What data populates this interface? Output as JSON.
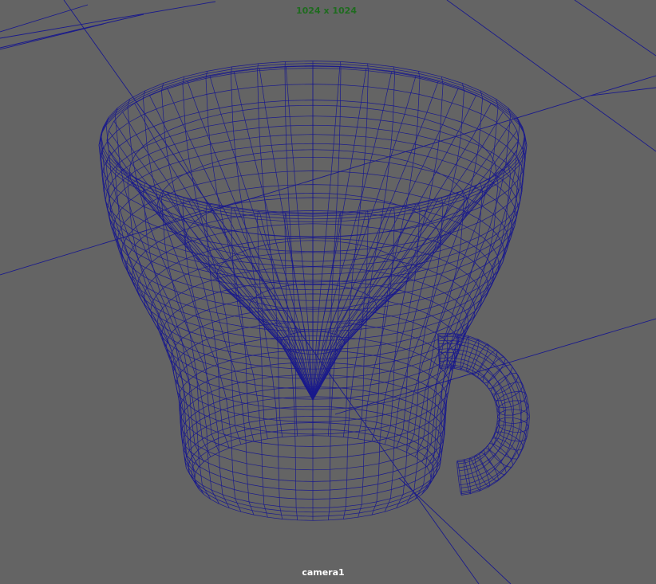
{
  "viewport": {
    "resolution_label": "1024 x 1024",
    "camera_name": "camera1",
    "display_mode": "wireframe",
    "object": "teacup-mesh"
  },
  "colors": {
    "background": "#646464",
    "wireframe": "#1a1a8c",
    "grid": "#1a1a8c",
    "resolution_text": "#1f6b1f",
    "camera_text": "#ffffff"
  }
}
